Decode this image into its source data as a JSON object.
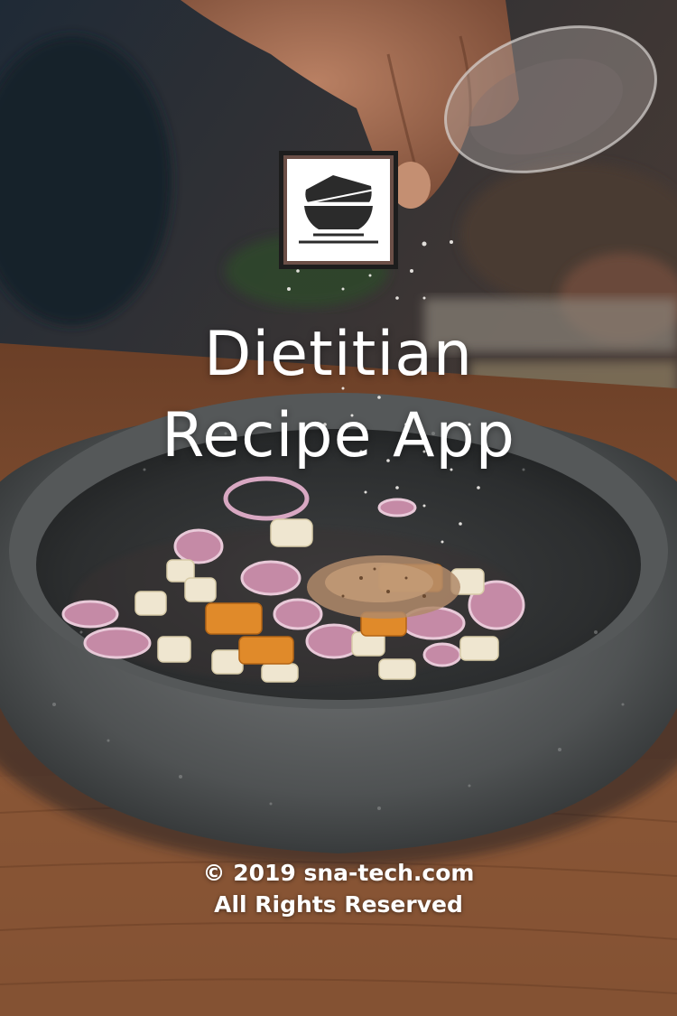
{
  "splash": {
    "title_line1": "Dietitian",
    "title_line2": "Recipe App",
    "copyright": "© 2019 sna-tech.com",
    "rights": "All Rights Reserved"
  },
  "logo": {
    "icon": "stacked-bowls-icon"
  },
  "background": {
    "subject": "stone mortar bowl with chopped onions and spices on wooden table"
  },
  "colors": {
    "text": "#ffffff",
    "logo_frame": "#1d1d1d",
    "logo_border": "#6b4f47",
    "logo_bg": "#ffffff",
    "bowl_icon": "#2b2b2b"
  }
}
